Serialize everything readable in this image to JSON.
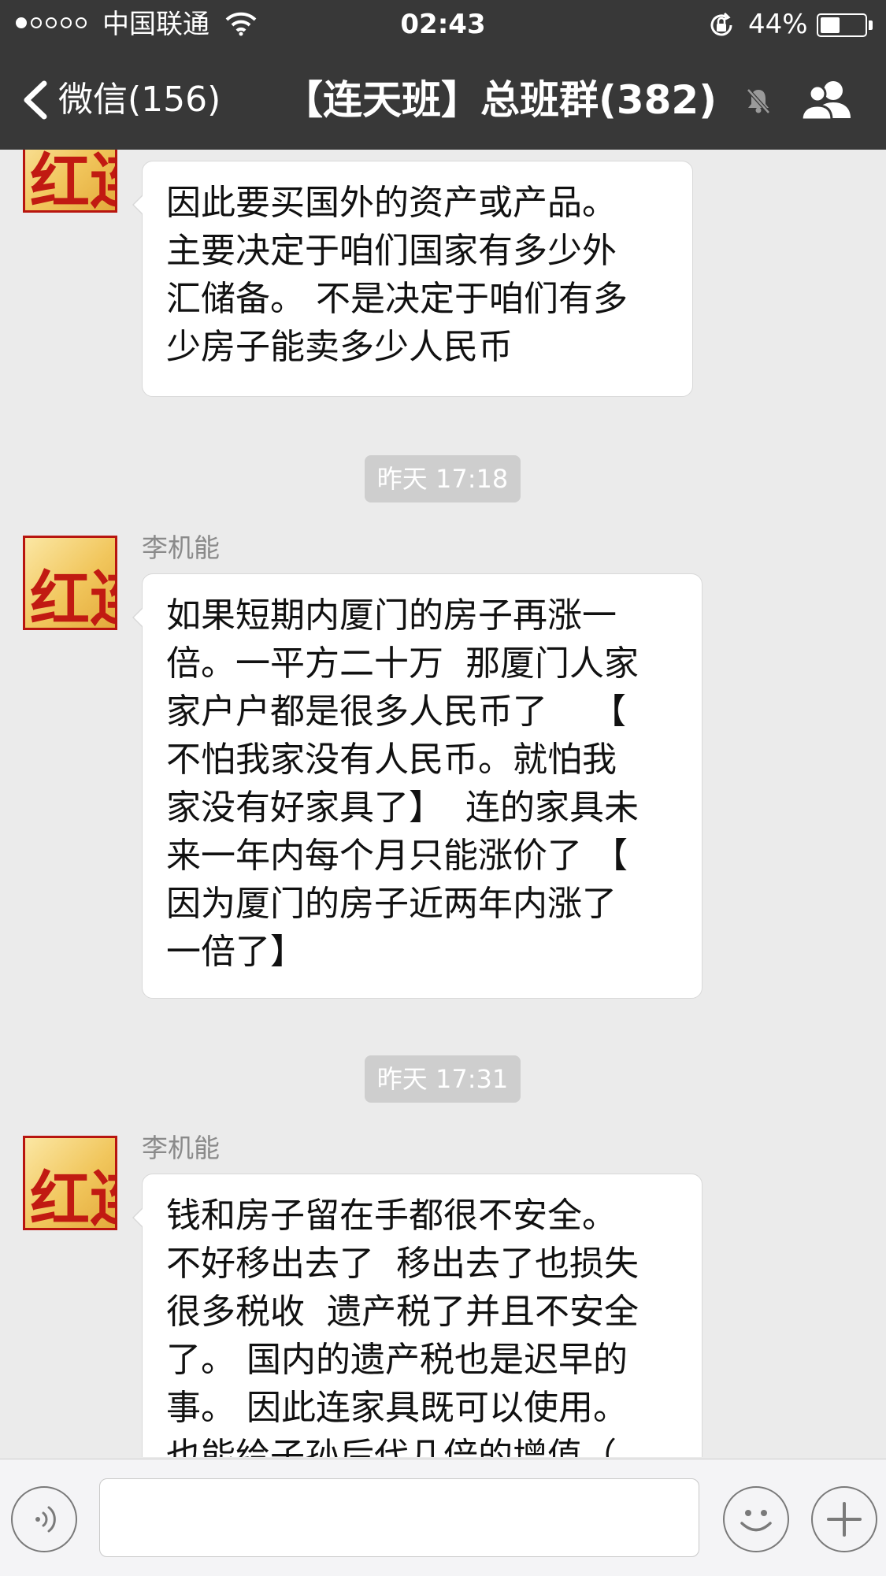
{
  "status_bar": {
    "carrier": "中国联通",
    "time": "02:43",
    "battery": "44%",
    "battery_level": 0.44
  },
  "nav": {
    "back_label": "微信(156)",
    "title": "【连天班】总班群(382)",
    "icons": [
      "chevron-left-icon",
      "mute-bell-icon",
      "group-members-icon"
    ]
  },
  "messages": [
    {
      "type": "text",
      "sender": "",
      "text": "因此要买国外的资产或产品。\n主要决定于咱们国家有多少外\n汇储备。 不是决定于咱们有多\n少房子能卖多少人民币"
    },
    {
      "type": "time",
      "text": "昨天 17:18"
    },
    {
      "type": "text",
      "sender": "李机能",
      "text": "如果短期内厦门的房子再涨一\n倍。一平方二十万  那厦门人家\n家户户都是很多人民币了    【\n不怕我家没有人民币。就怕我\n家没有好家具了】  连的家具未\n来一年内每个月只能涨价了 【\n因为厦门的房子近两年内涨了\n一倍了】"
    },
    {
      "type": "time",
      "text": "昨天 17:31"
    },
    {
      "type": "text",
      "sender": "李机能",
      "text": "钱和房子留在手都很不安全。\n不好移出去了  移出去了也损失\n很多税收  遗产税了并且不安全\n了。 国内的遗产税也是迟早的\n事。 因此连家具既可以使用。\n也能给子孙后代几倍的增值（"
    }
  ],
  "avatar": {
    "glyphs": "红连天"
  },
  "input_bar": {
    "value": "",
    "icons": [
      "voice-icon",
      "emoji-icon",
      "plus-icon"
    ]
  },
  "colors": {
    "nav_background": "#383838",
    "chat_background": "#ebebeb",
    "bubble": "#ffffff",
    "time_pill": "#cecece"
  }
}
